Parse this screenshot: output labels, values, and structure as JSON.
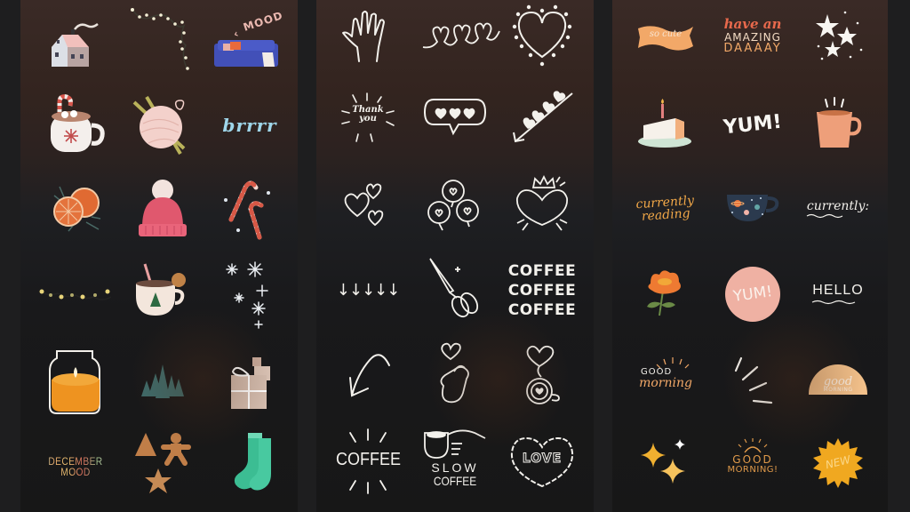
{
  "panels": [
    {
      "name": "cozy-winter",
      "stickers": [
        {
          "name": "cottage"
        },
        {
          "name": "string-lights"
        },
        {
          "name": "sofa-mood",
          "text": "MOOD"
        },
        {
          "name": "cocoa-mug-candy-cane"
        },
        {
          "name": "yarn-ball"
        },
        {
          "name": "brrrr",
          "text": "brrrr"
        },
        {
          "name": "orange-slices"
        },
        {
          "name": "pink-beanie"
        },
        {
          "name": "candy-canes"
        },
        {
          "name": "fairy-lights"
        },
        {
          "name": "cocoa-mug-gingerbread"
        },
        {
          "name": "snowflakes"
        },
        {
          "name": "candle-jar"
        },
        {
          "name": "pine-trees"
        },
        {
          "name": "gift-boxes"
        },
        {
          "name": "december-mood",
          "text": "DECEMBER MOOD"
        },
        {
          "name": "gingerbread-cookies"
        },
        {
          "name": "green-socks"
        }
      ]
    },
    {
      "name": "white-doodles",
      "stickers": [
        {
          "name": "hand-wave"
        },
        {
          "name": "heart-loops"
        },
        {
          "name": "dotted-heart"
        },
        {
          "name": "thank-you",
          "text": "Thank you"
        },
        {
          "name": "hearts-speech-bubble"
        },
        {
          "name": "hearts-arrow"
        },
        {
          "name": "three-hearts"
        },
        {
          "name": "heart-bubbles"
        },
        {
          "name": "crowned-heart"
        },
        {
          "name": "down-arrows"
        },
        {
          "name": "scissors"
        },
        {
          "name": "coffee-x3",
          "text": "COFFEE COFFEE COFFEE"
        },
        {
          "name": "curved-arrow"
        },
        {
          "name": "finger-heart"
        },
        {
          "name": "latte-heart"
        },
        {
          "name": "coffee-burst",
          "text": "COFFEE"
        },
        {
          "name": "slow-coffee",
          "text": "SLOW COFFEE"
        },
        {
          "name": "love-heart",
          "text": "LOVE"
        }
      ]
    },
    {
      "name": "warm-lettering",
      "stickers": [
        {
          "name": "so-cute-banner",
          "text": "so cute"
        },
        {
          "name": "have-an-amazing-day",
          "text_lines": [
            "have an",
            "AMAZING",
            "DAAAAY"
          ]
        },
        {
          "name": "stars"
        },
        {
          "name": "birthday-cake"
        },
        {
          "name": "yum-text",
          "text": "YUM!"
        },
        {
          "name": "coffee-cup"
        },
        {
          "name": "currently-reading",
          "text_lines": [
            "currently",
            "reading"
          ]
        },
        {
          "name": "galaxy-cup"
        },
        {
          "name": "currently",
          "text": "currently:"
        },
        {
          "name": "orange-flower"
        },
        {
          "name": "yum-circle",
          "text": "YUM!"
        },
        {
          "name": "hello",
          "text": "HELLO"
        },
        {
          "name": "good-morning-script",
          "text_lines": [
            "GOOD",
            "morning"
          ]
        },
        {
          "name": "burst-lines"
        },
        {
          "name": "good-morning-semicircle",
          "text_lines": [
            "good",
            "MORNING"
          ]
        },
        {
          "name": "sparkles"
        },
        {
          "name": "good-morning-sun",
          "text_lines": [
            "GOOD",
            "MORNING!"
          ]
        },
        {
          "name": "new-badge",
          "text": "NEW"
        }
      ]
    }
  ],
  "colors": {
    "chalk": "#f3f1ec",
    "peach": "#f2a868",
    "coral": "#e8694c",
    "mustard": "#f0b030",
    "pink": "#e9a9a0",
    "teal": "#3dbc95",
    "navy": "#2b3a4e"
  }
}
